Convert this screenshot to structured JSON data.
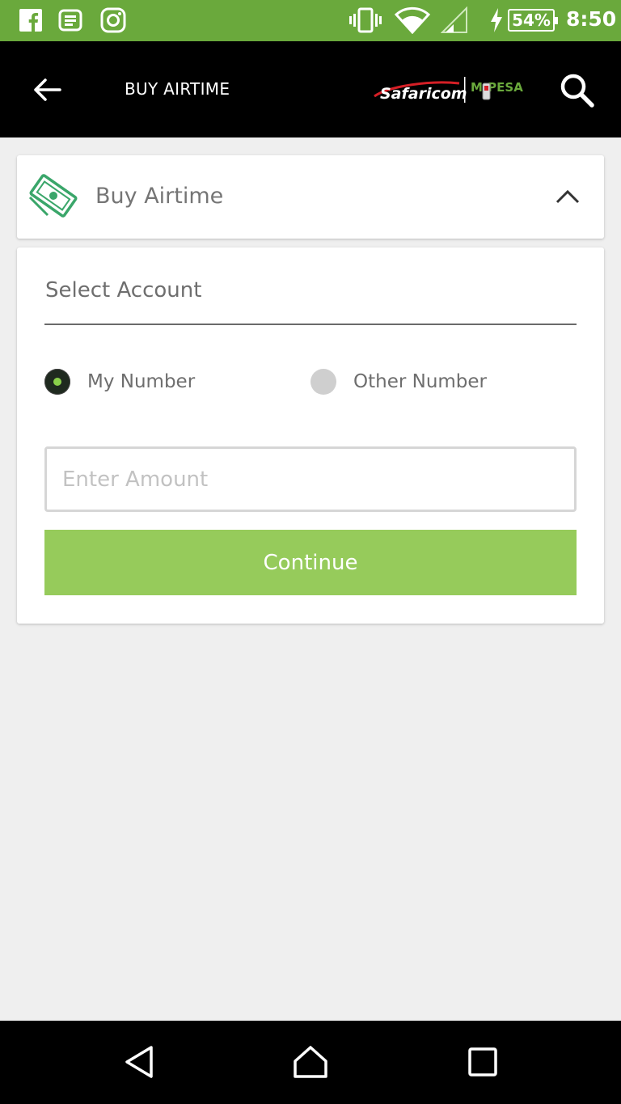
{
  "status_bar": {
    "battery": "54%",
    "time": "8:50",
    "icons": [
      "facebook-icon",
      "list-notification-icon",
      "instagram-icon",
      "vibrate-icon",
      "wifi-icon",
      "signal-icon",
      "charging-icon",
      "battery-icon"
    ]
  },
  "app_bar": {
    "title": "BUY AIRTIME",
    "brand_primary": "Safaricom",
    "brand_secondary": "M-PESA"
  },
  "section": {
    "title": "Buy Airtime",
    "expanded": true
  },
  "form": {
    "select_account_label": "Select Account",
    "radio_options": [
      {
        "label": "My Number",
        "selected": true
      },
      {
        "label": "Other Number",
        "selected": false
      }
    ],
    "amount_placeholder": "Enter Amount",
    "amount_value": "",
    "continue_label": "Continue"
  },
  "colors": {
    "status_bar": "#6aa93c",
    "app_bar": "#000000",
    "accent": "#96cb5b",
    "icon_green": "#3aa66a",
    "brand_red": "#d51f26"
  }
}
